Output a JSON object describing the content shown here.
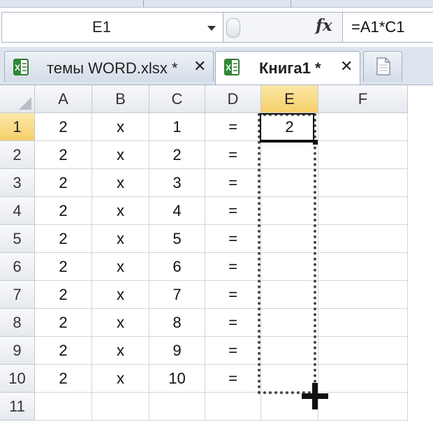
{
  "name_box": {
    "value": "E1"
  },
  "formula_bar": {
    "fx_label": "fx",
    "formula": "=A1*C1"
  },
  "tabs": [
    {
      "label": "темы WORD.xlsx *",
      "close": "✕",
      "active": false,
      "icon": "excel-icon"
    },
    {
      "label": "Книга1 *",
      "close": "✕",
      "active": true,
      "icon": "excel-icon"
    }
  ],
  "new_tab_icon": "document-icon",
  "sheet": {
    "columns": [
      "A",
      "B",
      "C",
      "D",
      "E",
      "F"
    ],
    "rows": [
      {
        "num": "1",
        "cells": [
          "2",
          "x",
          "1",
          "=",
          "2",
          ""
        ]
      },
      {
        "num": "2",
        "cells": [
          "2",
          "x",
          "2",
          "=",
          "",
          ""
        ]
      },
      {
        "num": "3",
        "cells": [
          "2",
          "x",
          "3",
          "=",
          "",
          ""
        ]
      },
      {
        "num": "4",
        "cells": [
          "2",
          "x",
          "4",
          "=",
          "",
          ""
        ]
      },
      {
        "num": "5",
        "cells": [
          "2",
          "x",
          "5",
          "=",
          "",
          ""
        ]
      },
      {
        "num": "6",
        "cells": [
          "2",
          "x",
          "6",
          "=",
          "",
          ""
        ]
      },
      {
        "num": "7",
        "cells": [
          "2",
          "x",
          "7",
          "=",
          "",
          ""
        ]
      },
      {
        "num": "8",
        "cells": [
          "2",
          "x",
          "8",
          "=",
          "",
          ""
        ]
      },
      {
        "num": "9",
        "cells": [
          "2",
          "x",
          "9",
          "=",
          "",
          ""
        ]
      },
      {
        "num": "10",
        "cells": [
          "2",
          "x",
          "10",
          "=",
          "",
          ""
        ]
      },
      {
        "num": "11",
        "cells": [
          "",
          "",
          "",
          "",
          "",
          ""
        ]
      }
    ],
    "selected_column": "E",
    "selected_row": "1",
    "selection_range": "E1:E10",
    "fill_cursor_icon": "crosshair-plus-icon"
  }
}
